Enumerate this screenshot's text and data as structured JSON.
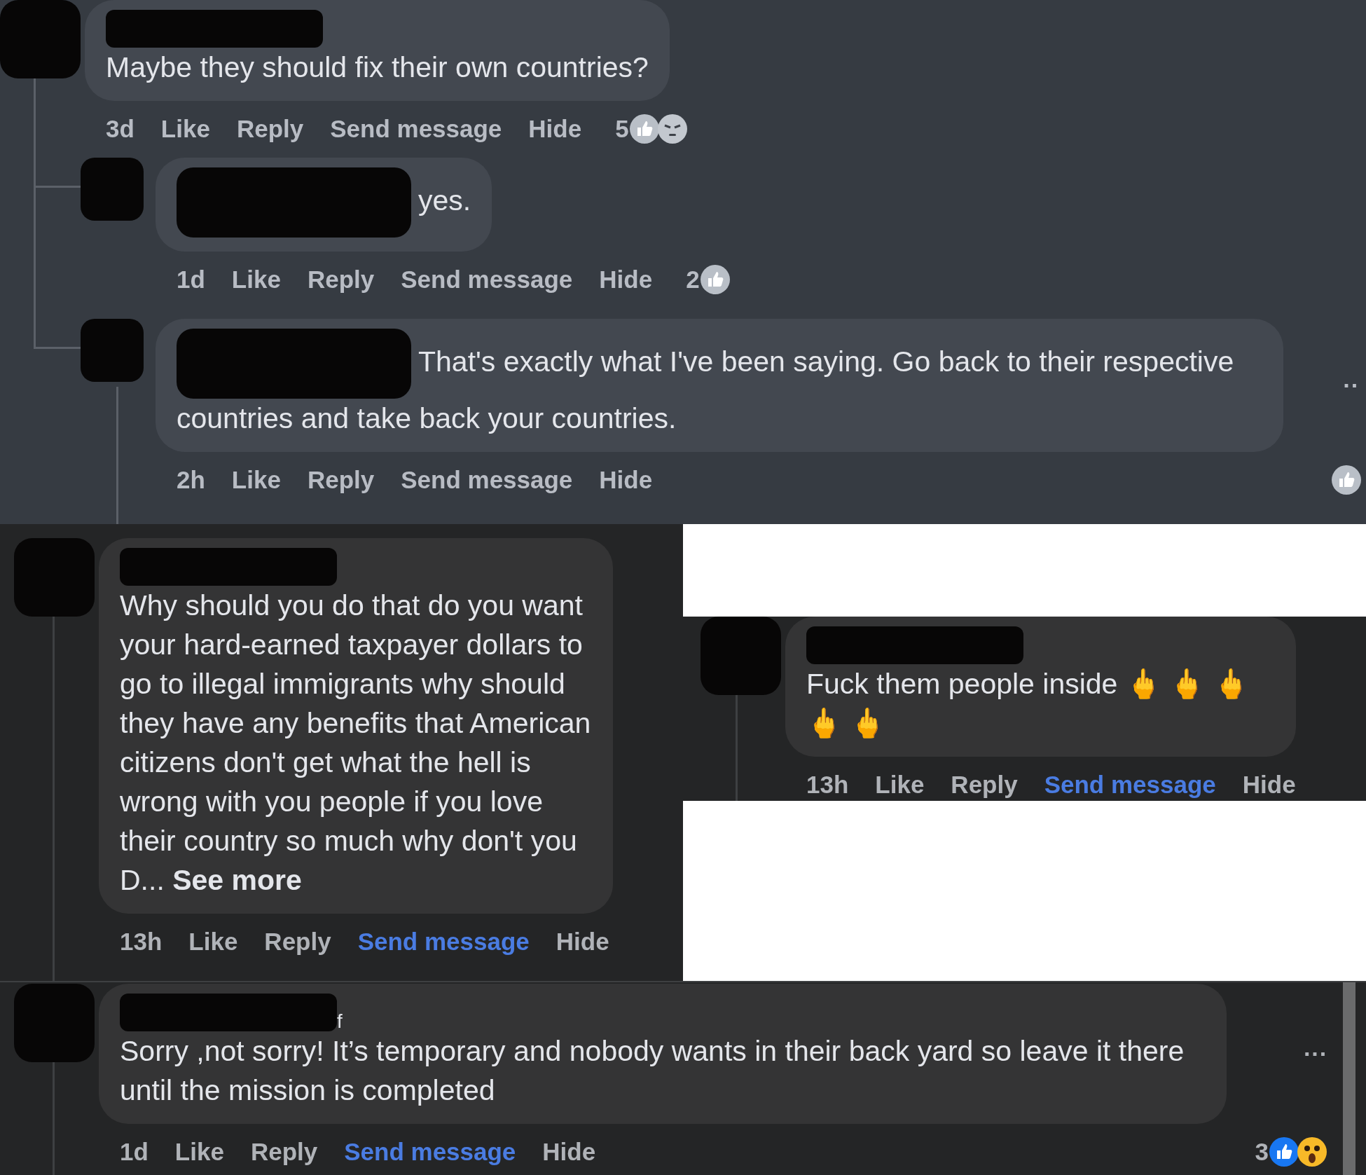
{
  "panels": [
    {
      "kind": "slate",
      "comments": [
        {
          "kind": "name-bar",
          "text": "Maybe they should fix their own countries?",
          "time": "3d",
          "actions": [
            {
              "label": "Like",
              "highlighted": false
            },
            {
              "label": "Reply",
              "highlighted": false
            },
            {
              "label": "Send message",
              "highlighted": false
            },
            {
              "label": "Hide",
              "highlighted": false
            }
          ],
          "reaction_count": "5",
          "reactions_right": false,
          "reactions": [
            {
              "kind": "like"
            },
            {
              "kind": "angry"
            }
          ],
          "children": [
            {
              "kind": "name-block",
              "text": "yes.",
              "time": "1d",
              "actions": [
                {
                  "label": "Like",
                  "highlighted": false
                },
                {
                  "label": "Reply",
                  "highlighted": false
                },
                {
                  "label": "Send message",
                  "highlighted": false
                },
                {
                  "label": "Hide",
                  "highlighted": false
                }
              ],
              "reaction_count": "2",
              "reactions_right": false,
              "reactions": [
                {
                  "kind": "like"
                }
              ]
            },
            {
              "kind": "name-block",
              "text": "That's exactly what I've been saying. Go back to their respective countries and take back your countries.",
              "time": "2h",
              "actions": [
                {
                  "label": "Like",
                  "highlighted": false
                },
                {
                  "label": "Reply",
                  "highlighted": false
                },
                {
                  "label": "Send message",
                  "highlighted": false
                },
                {
                  "label": "Hide",
                  "highlighted": false
                }
              ],
              "reactions_right": true,
              "reactions": [
                {
                  "kind": "like"
                }
              ],
              "menu": "··"
            }
          ]
        }
      ]
    },
    {
      "kind": "dark",
      "comments": [
        {
          "kind": "name-bar",
          "text": "Why should you do that do you want your hard-earned taxpayer dollars to go to illegal immigrants why should they have any benefits that American citizens don't get what the hell is wrong with you people if you love their country so much why don't you D...",
          "see_more": "See more",
          "time": "13h",
          "actions": [
            {
              "label": "Like",
              "highlighted": false
            },
            {
              "label": "Reply",
              "highlighted": false
            },
            {
              "label": "Send message",
              "highlighted": true
            },
            {
              "label": "Hide",
              "highlighted": false
            }
          ]
        }
      ]
    },
    {
      "kind": "dark",
      "comments": [
        {
          "kind": "name-bar",
          "text": "Fuck them people inside 🖕 🖕 🖕 🖕 🖕",
          "time": "13h",
          "actions": [
            {
              "label": "Like",
              "highlighted": false
            },
            {
              "label": "Reply",
              "highlighted": false
            },
            {
              "label": "Send message",
              "highlighted": true
            },
            {
              "label": "Hide",
              "highlighted": false
            }
          ]
        }
      ]
    },
    {
      "kind": "dark",
      "comments": [
        {
          "kind": "name-bar",
          "name_fragment": "f",
          "text": "Sorry ,not sorry! It’s temporary and nobody wants in their back yard so leave it there until the mission is completed",
          "time": "1d",
          "actions": [
            {
              "label": "Like",
              "highlighted": false
            },
            {
              "label": "Reply",
              "highlighted": false
            },
            {
              "label": "Send message",
              "highlighted": true
            },
            {
              "label": "Hide",
              "highlighted": false
            }
          ],
          "reaction_count": "3",
          "reactions_right": true,
          "reactions": [
            {
              "kind": "like"
            },
            {
              "kind": "wow"
            }
          ],
          "menu": "···"
        }
      ]
    }
  ]
}
